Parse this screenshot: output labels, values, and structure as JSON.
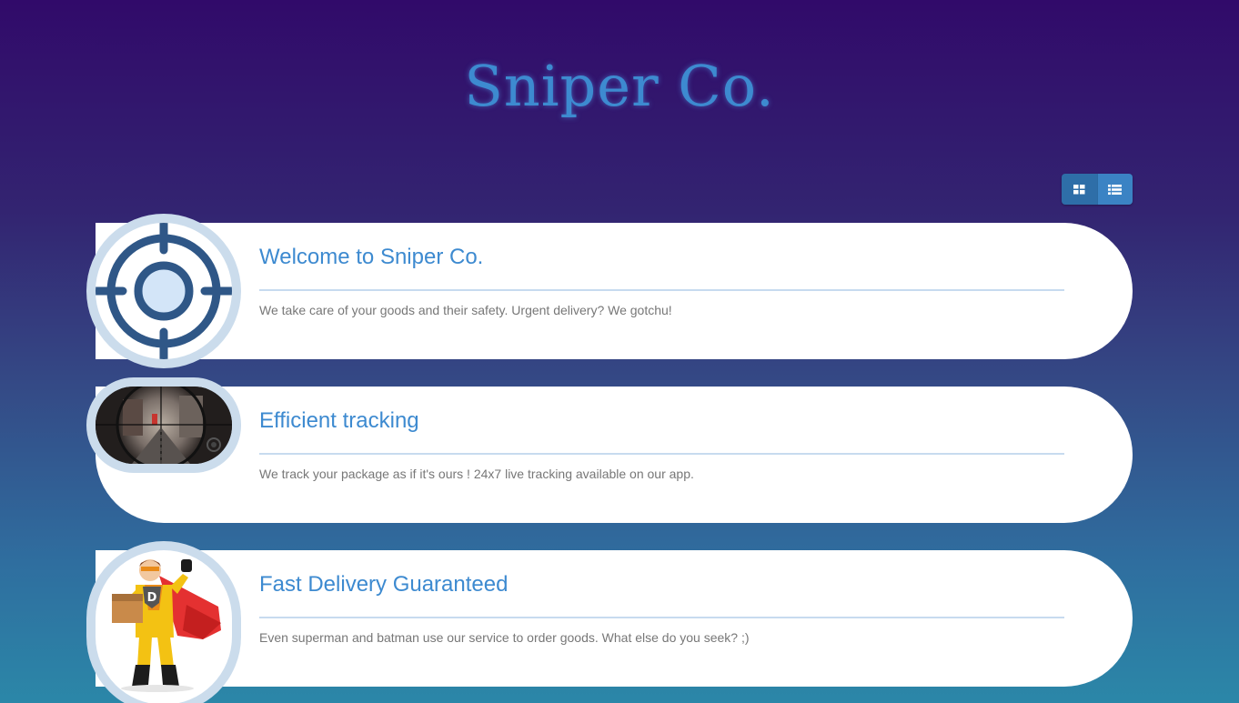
{
  "header": {
    "title": "Sniper Co."
  },
  "view_toggle": {
    "grid_icon": "grid-icon",
    "list_icon": "list-icon"
  },
  "cards": [
    {
      "title": "Welcome to Sniper Co.",
      "text": "We take care of your goods and their safety. Urgent delivery? We gotchu!",
      "image": "crosshair-icon"
    },
    {
      "title": "Efficient tracking",
      "text": "We track your package as if it's ours ! 24x7 live tracking available on our app.",
      "image": "scope-view-image"
    },
    {
      "title": "Fast Delivery Guaranteed",
      "text": "Even superman and batman use our service to order goods. What else do you seek? ;)",
      "image": "delivery-superhero-image"
    }
  ],
  "colors": {
    "accent": "#3d8ad0",
    "rule": "#c7dbef",
    "body_text": "#777777",
    "button": "#3b83c4"
  }
}
